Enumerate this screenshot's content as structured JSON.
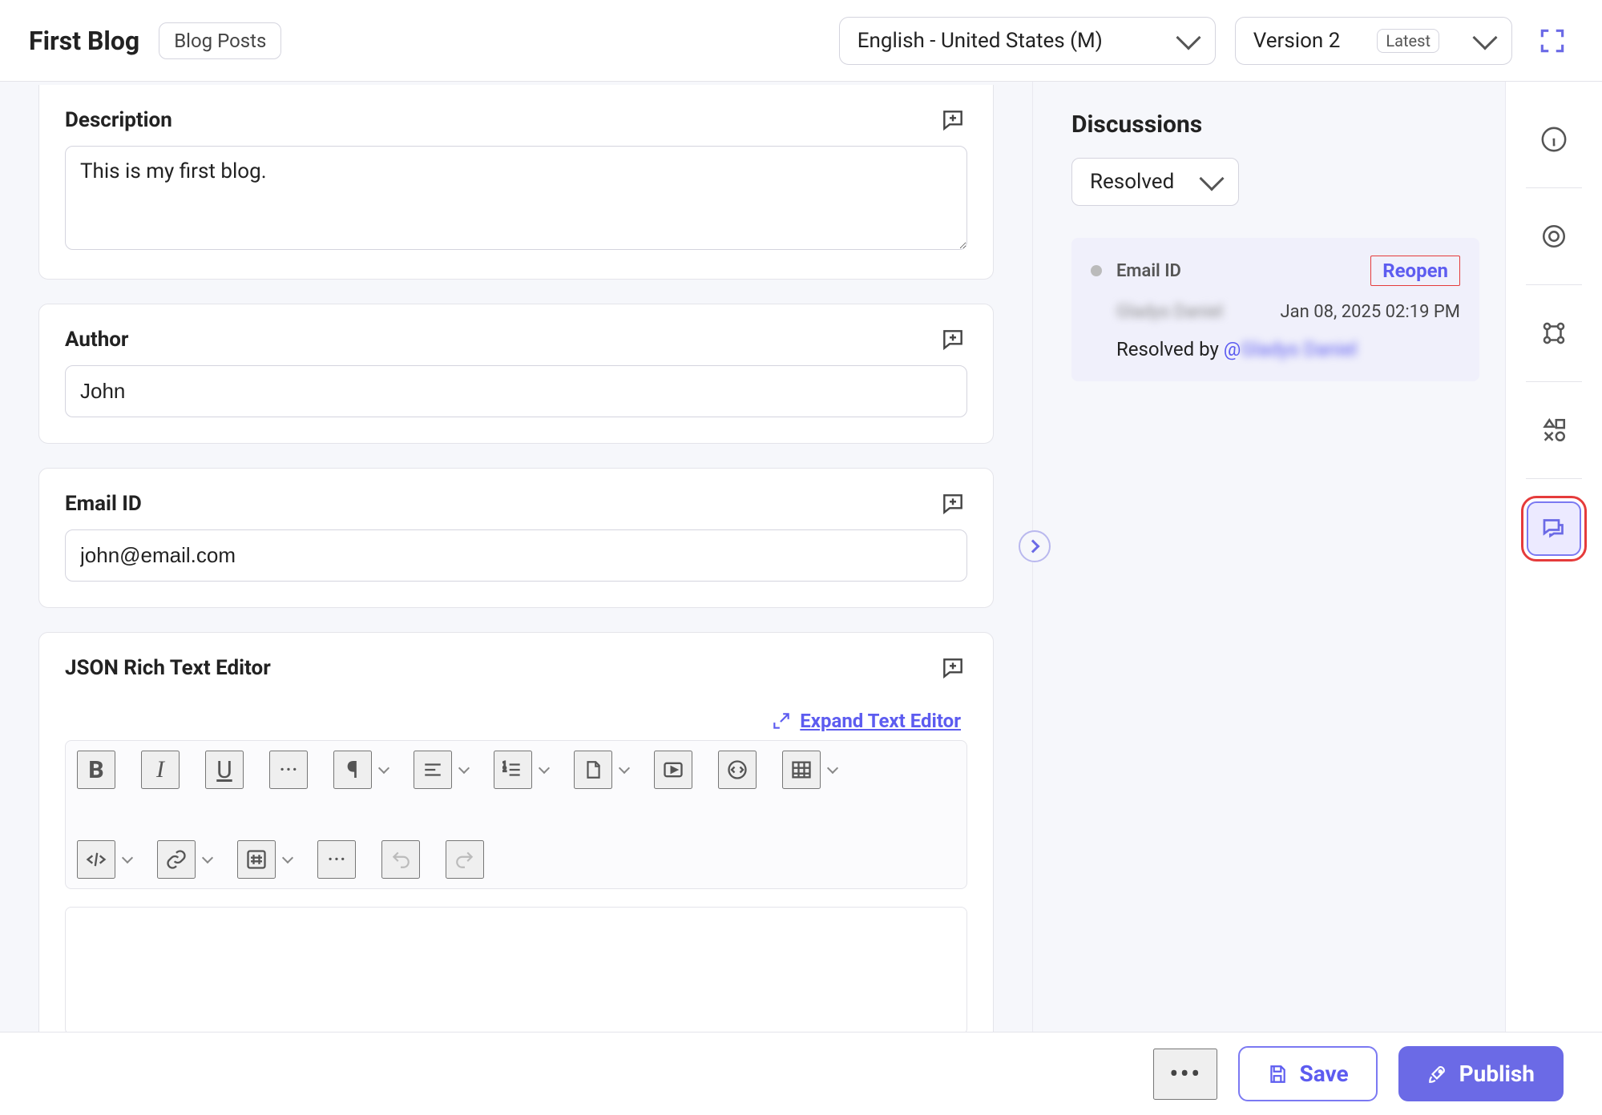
{
  "header": {
    "title": "First Blog",
    "type_chip": "Blog Posts",
    "language": "English - United States (M)",
    "version_label": "Version 2",
    "version_badge": "Latest"
  },
  "fields": {
    "description": {
      "label": "Description",
      "value": "This is my first blog."
    },
    "author": {
      "label": "Author",
      "value": "John"
    },
    "email": {
      "label": "Email ID",
      "value": "john@email.com"
    },
    "rte": {
      "label": "JSON Rich Text Editor",
      "expand_label": "Expand Text Editor"
    }
  },
  "side": {
    "title": "Discussions",
    "filter": "Resolved"
  },
  "discussion": {
    "field_name": "Email ID",
    "action": "Reopen",
    "author_masked": "Gladys Daniel",
    "timestamp": "Jan 08, 2025 02:19 PM",
    "resolved_prefix": "Resolved by ",
    "resolved_by_mention": "@",
    "resolved_by_masked": "Gladys Daniel"
  },
  "footer": {
    "save": "Save",
    "publish": "Publish"
  }
}
